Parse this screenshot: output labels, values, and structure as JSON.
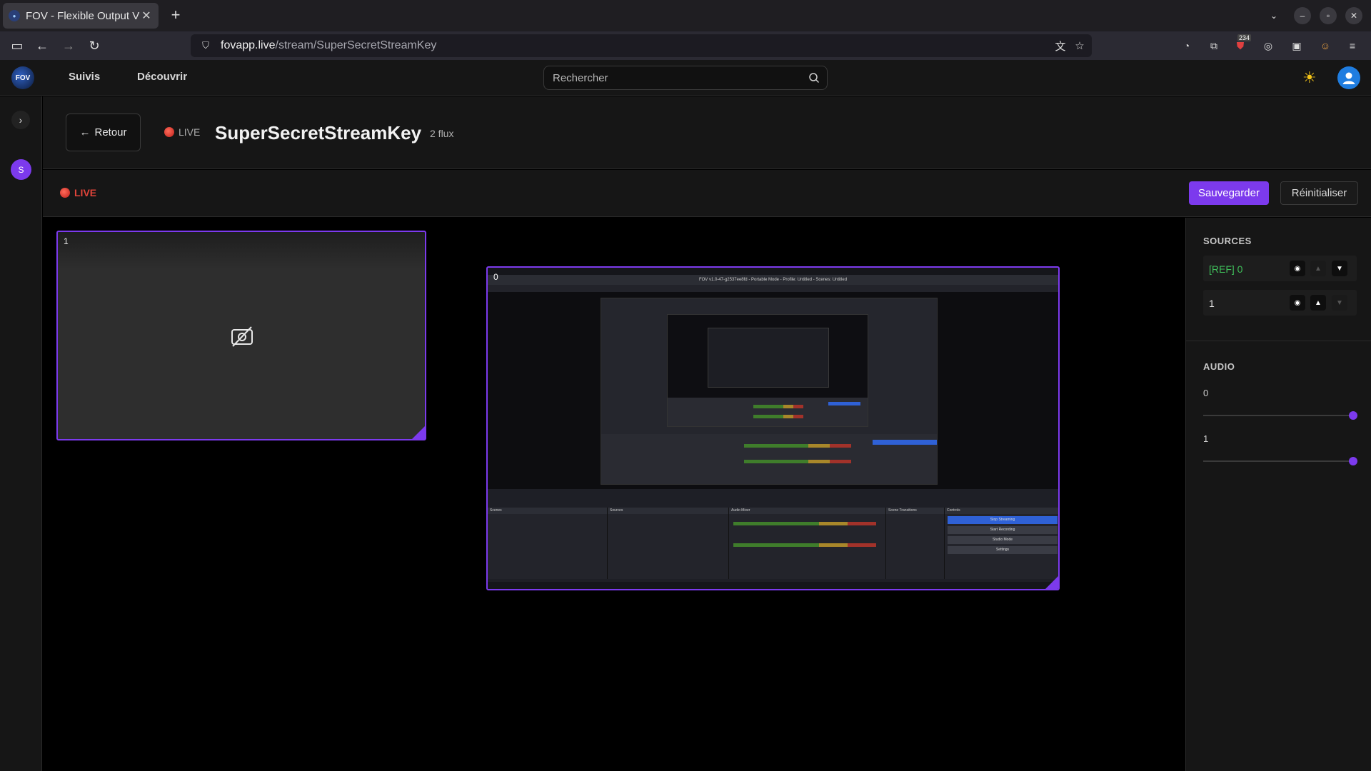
{
  "browser": {
    "tab_title": "FOV - Flexible Output V",
    "tab_close": "✕",
    "new_tab": "+",
    "url_host": "fovapp.live",
    "url_path": "/stream/SuperSecretStreamKey",
    "extension_badge": "234"
  },
  "header": {
    "logo_text": "FOV",
    "nav": [
      "Suivis",
      "Découvrir"
    ],
    "search_placeholder": "Rechercher"
  },
  "sidebar": {
    "avatar_initial": "S"
  },
  "titlebar": {
    "back_label": "Retour",
    "live_label": "LIVE",
    "stream_title": "SuperSecretStreamKey",
    "flux_count": "2 flux"
  },
  "toolbar": {
    "live_label": "LIVE",
    "save_label": "Sauvegarder",
    "reset_label": "Réinitialiser"
  },
  "canvas": {
    "tiles": [
      {
        "label": "1",
        "state": "camera-off"
      },
      {
        "label": "0",
        "state": "screen-share"
      }
    ],
    "obs_window_title": "FOV v1.0-47-g2537ee8fd - Portable Mode - Profile: Untitled - Scenes: Untitled",
    "obs_docks": [
      "Scenes",
      "Sources",
      "Audio Mixer",
      "Scene Transitions",
      "Controls"
    ],
    "obs_controls": [
      "Stop Streaming",
      "Start Recording",
      "Studio Mode",
      "Settings"
    ]
  },
  "sources_panel": {
    "title": "SOURCES",
    "items": [
      {
        "name": "[REF] 0",
        "highlight_color": "#3fbf5a",
        "up_enabled": false,
        "down_enabled": true
      },
      {
        "name": "1",
        "highlight_color": "#e8e8e8",
        "up_enabled": true,
        "down_enabled": false
      }
    ]
  },
  "audio_panel": {
    "title": "AUDIO",
    "channels": [
      {
        "name": "0",
        "volume": 1.0
      },
      {
        "name": "1",
        "volume": 1.0
      }
    ]
  },
  "colors": {
    "accent": "#7c3aed",
    "live_red": "#e0443a",
    "ref_green": "#3fbf5a"
  }
}
